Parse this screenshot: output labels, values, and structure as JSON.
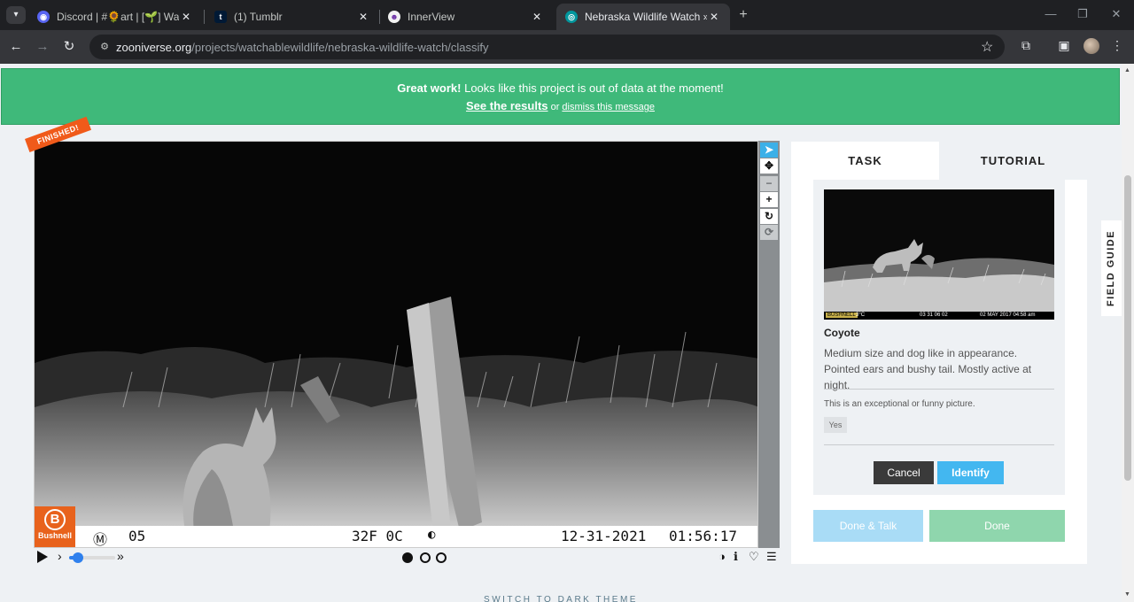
{
  "browser": {
    "tabs": [
      {
        "title": "Discord | #🌻art | [🌱] Warrior",
        "favicon": "discord-icon",
        "active": false
      },
      {
        "title": "(1) Tumblr",
        "favicon": "tumblr-icon",
        "active": false
      },
      {
        "title": "InnerView",
        "favicon": "innerview-icon",
        "active": false
      },
      {
        "title": "Nebraska Wildlife Watch » Classif",
        "favicon": "zooniverse-icon",
        "active": true
      }
    ],
    "url_host": "zooniverse.org",
    "url_path": "/projects/watchablewildlife/nebraska-wildlife-watch/classify"
  },
  "banner": {
    "strong": "Great work!",
    "message": " Looks like this project is out of data at the moment!",
    "see_results": "See the results",
    "or": " or ",
    "dismiss": "dismiss this message",
    "color": "#3fb97a"
  },
  "viewer": {
    "finished_label": "FINISHED!",
    "brand": "Bushnell",
    "brand_letter": "B",
    "strip": {
      "mode": "Ⓜ",
      "frame": "05",
      "temperature": "32F  0C",
      "date": "12-31-2021",
      "time": "01:56:17"
    }
  },
  "panel": {
    "tab_task": "TASK",
    "tab_tutorial": "TUTORIAL",
    "thumbnail_strip": {
      "brand": "BUSHNELL",
      "temp": "3°C",
      "code": "03 31 06 02",
      "datetime": "02 MAY 2017  04:58 am"
    },
    "species": "Coyote",
    "description": "Medium size and dog like in appearance. Pointed ears and bushy tail. Mostly active at night.",
    "question": "This is an exceptional or funny picture.",
    "yes_label": "Yes",
    "cancel_label": "Cancel",
    "identify_label": "Identify",
    "done_talk_label": "Done & Talk",
    "done_label": "Done"
  },
  "field_guide_label": "FIELD GUIDE",
  "footer": {
    "dark_theme": "SWITCH TO DARK THEME"
  }
}
